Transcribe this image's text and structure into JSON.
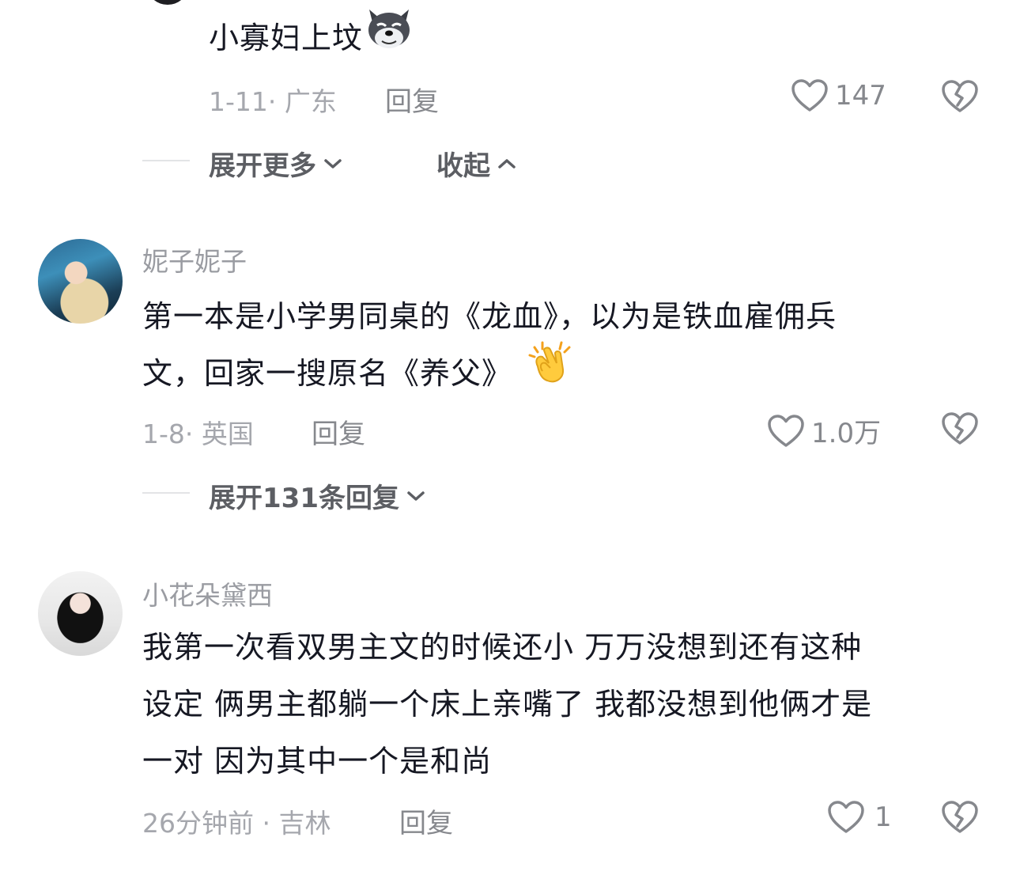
{
  "comments": [
    {
      "text": "小寡妇上坟",
      "emoji": "wolf-face-emoji",
      "date": "1-11",
      "location": "广东",
      "reply_label": "回复",
      "likes": "147"
    },
    {
      "username": "妮子妮子",
      "text_line1": "第一本是小学男同桌的《龙血》，以为是铁血雇佣兵",
      "text_line2": "文，回家一搜原名《养父》",
      "emoji": "clapping-hands-emoji",
      "date": "1-8",
      "location": "英国",
      "reply_label": "回复",
      "likes": "1.0万"
    },
    {
      "username": "小花朵黛西",
      "text_line1": "我第一次看双男主文的时候还小 万万没想到还有这种",
      "text_line2": "设定 俩男主都躺一个床上亲嘴了 我都没想到他俩才是",
      "text_line3": "一对 因为其中一个是和尚",
      "date": "26分钟前",
      "location": "吉林",
      "reply_label": "回复",
      "likes": "1"
    }
  ],
  "thread_controls": {
    "expand_more": "展开更多",
    "collapse": "收起",
    "expand_replies": "展开131条回复"
  },
  "separator": "·",
  "colors": {
    "text_primary": "#161823",
    "text_meta": "#a5a7ad",
    "icon_gray": "#86888d"
  }
}
